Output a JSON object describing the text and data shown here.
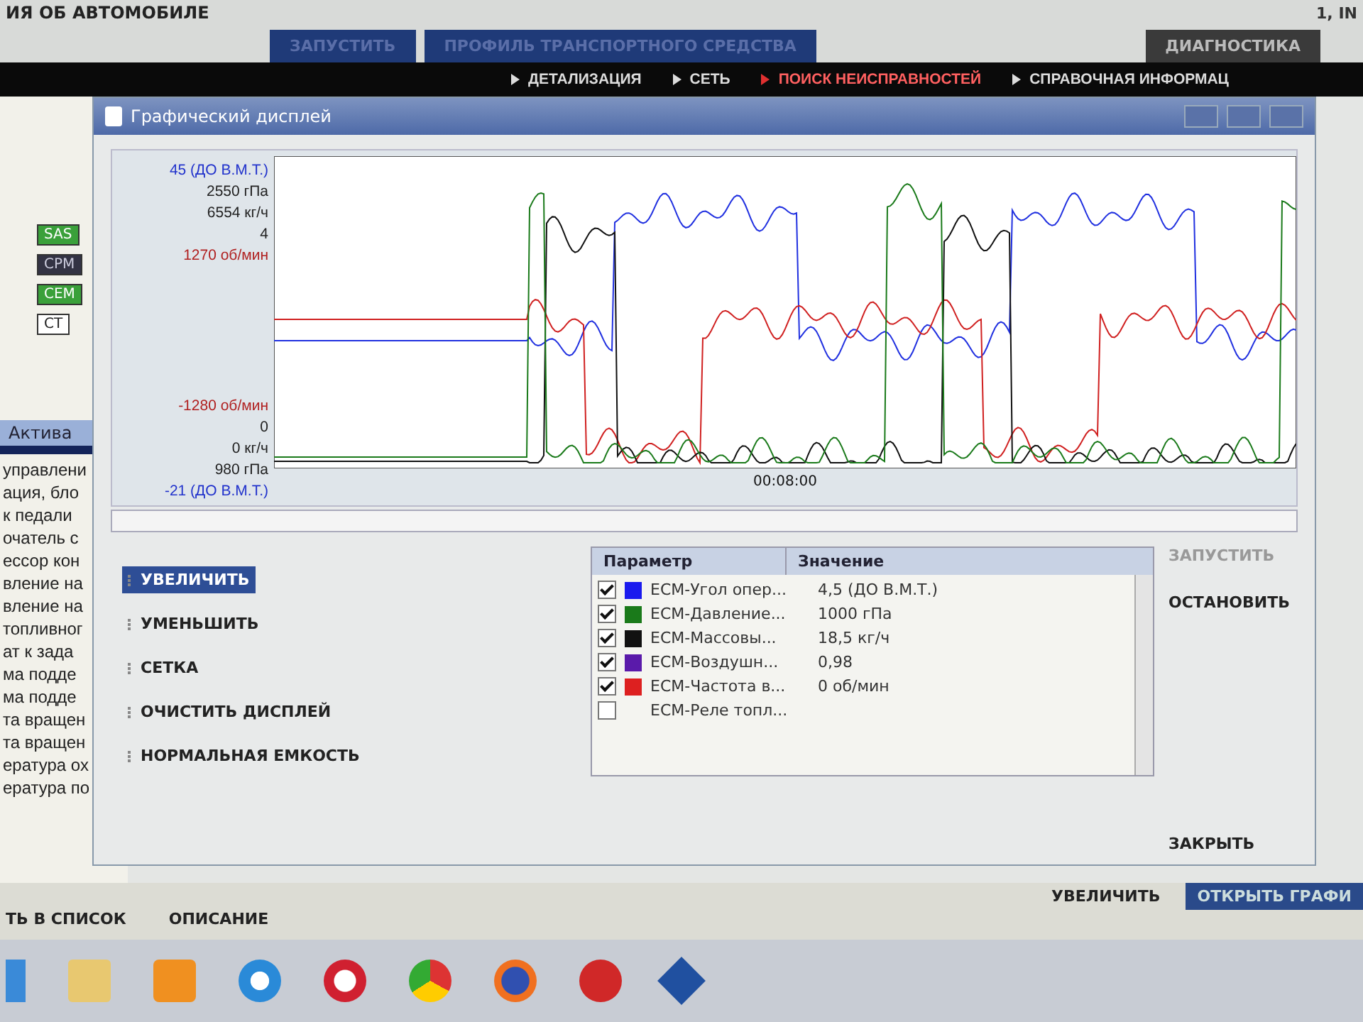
{
  "header": {
    "title": "ИЯ ОБ АВТОМОБИЛЕ",
    "right_text": "1, IN"
  },
  "tabs": [
    {
      "label": "ЗАПУСТИТЬ",
      "selected": false
    },
    {
      "label": "ПРОФИЛЬ ТРАНСПОРТНОГО СРЕДСТВА",
      "selected": false
    },
    {
      "label": "ДИАГНОСТИКА",
      "selected": true
    }
  ],
  "subnav": [
    {
      "label": "ДЕТАЛИЗАЦИЯ",
      "selected": false
    },
    {
      "label": "СЕТЬ",
      "selected": false
    },
    {
      "label": "ПОИСК НЕИСПРАВНОСТЕЙ",
      "selected": true
    },
    {
      "label": "СПРАВОЧНАЯ ИНФОРМАЦ",
      "selected": false
    }
  ],
  "network": {
    "nodes": [
      {
        "label": "SAS",
        "kind": "green"
      },
      {
        "label": "CPM",
        "kind": "dark"
      },
      {
        "label": "CEM",
        "kind": "green"
      },
      {
        "label": "CT",
        "kind": "plain"
      }
    ]
  },
  "background_tab": "Актива",
  "background_list": [
    "управлени",
    "ация, бло",
    "к педали",
    "очатель с",
    "ессор кон",
    "вление на",
    "вление на",
    "топливног",
    "ат к зада",
    "ма подде",
    "ма подде",
    "та вращен",
    "та вращен",
    "ература ох",
    "ература по"
  ],
  "bottom_links": [
    "ТЬ В СПИСОК",
    "ОПИСАНИЕ"
  ],
  "bottom_right_buttons": [
    {
      "label": "УВЕЛИЧИТЬ",
      "kind": "link"
    },
    {
      "label": "ОТКРЫТЬ ГРАФИ",
      "kind": "filled"
    }
  ],
  "dialog": {
    "title": "Графический дисплей",
    "axis_labels_top": [
      {
        "text": "45 (ДО В.М.Т.)",
        "color": "#2233cc"
      },
      {
        "text": "2550 гПа",
        "color": "#222222"
      },
      {
        "text": "6554 кг/ч",
        "color": "#222222"
      },
      {
        "text": "4",
        "color": "#222222"
      },
      {
        "text": "1270 об/мин",
        "color": "#b02020"
      }
    ],
    "axis_labels_bottom": [
      {
        "text": "-1280 об/мин",
        "color": "#b02020"
      },
      {
        "text": "0",
        "color": "#222222"
      },
      {
        "text": "0 кг/ч",
        "color": "#222222"
      },
      {
        "text": "980 гПа",
        "color": "#222222"
      },
      {
        "text": "-21 (ДО В.М.Т.)",
        "color": "#2233cc"
      }
    ],
    "time_label": "00:08:00",
    "actions": [
      {
        "label": "УВЕЛИЧИТЬ",
        "selected": true
      },
      {
        "label": "УМЕНЬШИТЬ",
        "selected": false
      },
      {
        "label": "СЕТКА",
        "selected": false
      },
      {
        "label": "ОЧИСТИТЬ ДИСПЛЕЙ",
        "selected": false
      },
      {
        "label": "НОРМАЛЬНАЯ ЕМКОСТЬ",
        "selected": false
      }
    ],
    "table": {
      "columns": [
        "Параметр",
        "Значение"
      ],
      "rows": [
        {
          "checked": true,
          "color": "#1a1aee",
          "name": "ECM-Угол опер...",
          "value": "4,5 (ДО В.М.Т.)"
        },
        {
          "checked": true,
          "color": "#1a7a1a",
          "name": "ECM-Давление...",
          "value": "1000 гПа"
        },
        {
          "checked": true,
          "color": "#111111",
          "name": "ECM-Массовы...",
          "value": "18,5 кг/ч"
        },
        {
          "checked": true,
          "color": "#5a1aaa",
          "name": "ECM-Воздушн...",
          "value": "0,98"
        },
        {
          "checked": true,
          "color": "#dd2020",
          "name": "ECM-Частота в...",
          "value": "0 об/мин"
        },
        {
          "checked": false,
          "name": "ECM-Реле топл..."
        }
      ]
    },
    "side_buttons": [
      {
        "label": "ЗАПУСТИТЬ",
        "disabled": true
      },
      {
        "label": "ОСТАНОВИТЬ",
        "disabled": false
      }
    ],
    "close_button": "ЗАКРЫТЬ"
  }
}
